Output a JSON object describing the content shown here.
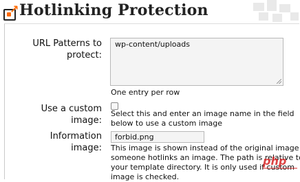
{
  "page": {
    "title": "Hotlinking Protection"
  },
  "form": {
    "url_patterns": {
      "label_line1": "URL Patterns to",
      "label_line2": "protect:",
      "value": "wp-content/uploads",
      "help": "One entry per row"
    },
    "custom_image": {
      "label_line1": "Use a custom",
      "label_line2": "image:",
      "checked": false,
      "help_line1": "Select this and enter an image name in the field",
      "help_line2": "below to use a custom image"
    },
    "information_image": {
      "label_line1": "Information",
      "label_line2": "image:",
      "value": "forbid.png",
      "help_line1": "This image is shown instead of the original image if",
      "help_line2": "someone hotlinks an image. The path is relative to",
      "help_line3": "your template directory. It is only used if custom",
      "help_line4": "image is checked."
    }
  },
  "watermark": {
    "text": "php"
  },
  "colors": {
    "accent": "#ff6a00",
    "field_bg": "#f4f4f4",
    "field_border": "#b8b8b8"
  }
}
